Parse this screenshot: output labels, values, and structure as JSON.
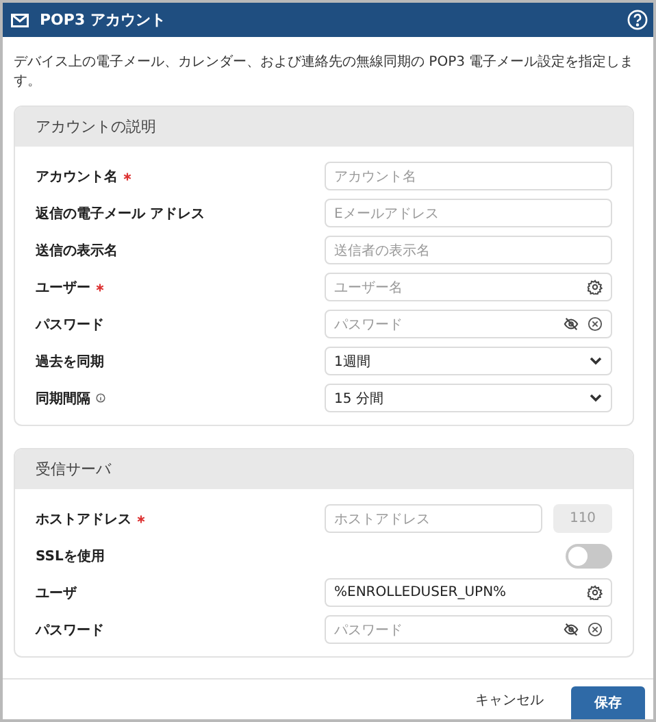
{
  "window": {
    "title": "POP3 アカウント"
  },
  "description": "デバイス上の電子メール、カレンダー、および連絡先の無線同期の POP3 電子メール設定を指定します。",
  "sections": [
    {
      "title": "アカウントの説明",
      "fields": [
        {
          "kind": "text",
          "label": "アカウント名",
          "required": true,
          "placeholder": "アカウント名"
        },
        {
          "kind": "text",
          "label": "返信の電子メール アドレス",
          "required": false,
          "placeholder": "Eメールアドレス"
        },
        {
          "kind": "text",
          "label": "送信の表示名",
          "required": false,
          "placeholder": "送信者の表示名"
        },
        {
          "kind": "user",
          "label": "ユーザー",
          "required": true,
          "placeholder": "ユーザー名"
        },
        {
          "kind": "password",
          "label": "パスワード",
          "required": false,
          "placeholder": "パスワード"
        },
        {
          "kind": "select",
          "label": "過去を同期",
          "required": false,
          "value": "1週間"
        },
        {
          "kind": "select",
          "label": "同期間隔",
          "required": false,
          "info": true,
          "value": "15 分間"
        }
      ]
    },
    {
      "title": "受信サーバ",
      "fields": [
        {
          "kind": "host",
          "label": "ホストアドレス",
          "required": true,
          "placeholder": "ホストアドレス",
          "port": "110"
        },
        {
          "kind": "toggle",
          "label": "SSLを使用",
          "required": false,
          "on": false
        },
        {
          "kind": "user",
          "label": "ユーザ",
          "required": false,
          "value": "%ENROLLEDUSER_UPN%"
        },
        {
          "kind": "password",
          "label": "パスワード",
          "required": false,
          "placeholder": "パスワード"
        }
      ]
    }
  ],
  "buttons": {
    "cancel": "キャンセル",
    "save": "保存"
  }
}
